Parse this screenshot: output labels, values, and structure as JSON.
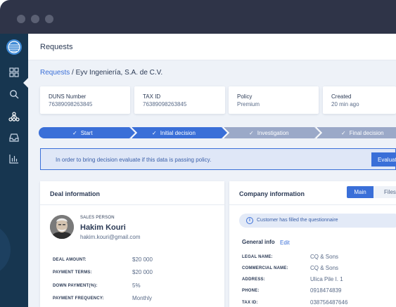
{
  "header": {
    "title": "Requests"
  },
  "breadcrumb": {
    "root": "Requests",
    "separator": " / ",
    "current": "Eyv Ingeniería, S.A. de C.V."
  },
  "sidebar": {
    "icons": [
      "globe-logo-icon",
      "grid-icon",
      "search-icon",
      "network-icon",
      "inbox-icon",
      "bar-chart-icon"
    ],
    "active": "network-icon"
  },
  "info_cards": [
    {
      "label": "DUNS Number",
      "value": "76389098263845"
    },
    {
      "label": "TAX ID",
      "value": "76389098263845"
    },
    {
      "label": "Policy",
      "value": "Premium"
    },
    {
      "label": "Created",
      "value": "20 min ago"
    }
  ],
  "steps": [
    {
      "label": "Start",
      "state": "complete"
    },
    {
      "label": "Initial decision",
      "state": "complete"
    },
    {
      "label": "Investigation",
      "state": "pending"
    },
    {
      "label": "Final decision",
      "state": "pending"
    }
  ],
  "alert": {
    "text": "In order to bring decision evaluate if this data is passing policy.",
    "button": "Evaluate"
  },
  "deal": {
    "title": "Deal information",
    "salesperson_label": "SALES PERSON",
    "salesperson_name": "Hakim Kouri",
    "salesperson_email": "hakim.kouri@gmail.com",
    "rows": [
      {
        "label": "DEAL AMOUNT:",
        "value": "$20 000"
      },
      {
        "label": "PAYMENT TERMS:",
        "value": "$20 000"
      },
      {
        "label": "DOWN PAYMENT(%):",
        "value": "5%"
      },
      {
        "label": "PAYMENT FREQUENCY:",
        "value": "Monthly"
      }
    ]
  },
  "company": {
    "title": "Company information",
    "tabs": [
      "Main",
      "Files"
    ],
    "active_tab": "Main",
    "notice": "Customer has filled the questionnaire",
    "general_info_label": "General info",
    "edit_label": "Edit",
    "rows": [
      {
        "label": "LEGAL NAME:",
        "value": "CQ & Sons"
      },
      {
        "label": "COMMERCIAL NAME:",
        "value": "CQ & Sons"
      },
      {
        "label": "ADDRESS:",
        "value": "Ulica Pile I. 1"
      },
      {
        "label": "PHONE:",
        "value": "0918474839"
      },
      {
        "label": "TAX ID:",
        "value": "038756487646"
      }
    ]
  },
  "colors": {
    "accent": "#3a6fd8",
    "step_complete": "#3a6fd8",
    "step_pending": "#9ba9c8",
    "sidebar": "#173650",
    "titlebar": "#2f3448"
  }
}
